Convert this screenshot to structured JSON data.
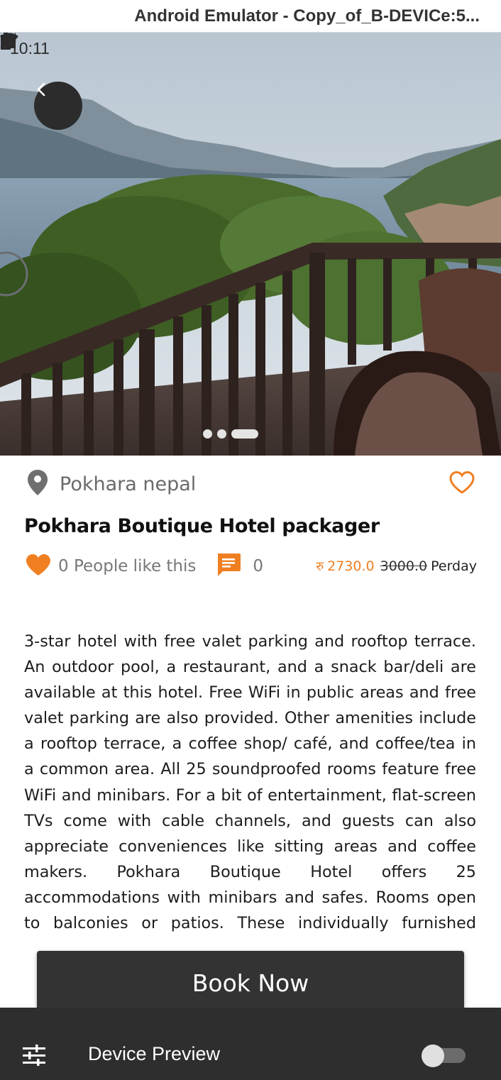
{
  "window": {
    "title": "Android Emulator - Copy_of_B-DEVICe:5..."
  },
  "status_bar": {
    "time": "10:11",
    "icons": [
      "android-debug-icon",
      "wifi-icon",
      "signal-icon",
      "battery-icon"
    ]
  },
  "hero": {
    "image_description_icon": "hotel-balcony-lake-photo",
    "carousel": {
      "count": 3,
      "active_index": 2
    }
  },
  "listing": {
    "location": "Pokhara nepal",
    "title": "Pokhara Boutique Hotel packager",
    "likes_text": "0 People like this",
    "comments_count": "0",
    "currency_symbol": "रु",
    "price": "2730.0",
    "old_price": "3000.0",
    "price_unit": "Perday",
    "description": "3-star hotel with free valet parking and rooftop terrace. An outdoor pool, a restaurant, and a snack bar/deli are available at this hotel. Free WiFi in public areas and free valet parking are also provided. Other amenities include a rooftop terrace, a coffee shop/ café, and coffee/tea in a common area. All 25 soundproofed rooms feature free WiFi and minibars. For a bit of entertainment, flat-screen TVs come with cable channels, and guests can also appreciate conveniences like sitting areas and coffee makers. Pokhara Boutique Hotel offers 25 accommodations with minibars and safes. Rooms open to balconies or patios. These individually furnished accommodations have separate sitting areas. Flat-"
  },
  "actions": {
    "book_label": "Book Now"
  },
  "device_preview": {
    "label": "Device Preview",
    "enabled": false
  },
  "colors": {
    "accent": "#f07f22",
    "button": "#333333",
    "bar": "#2e2e2e"
  }
}
